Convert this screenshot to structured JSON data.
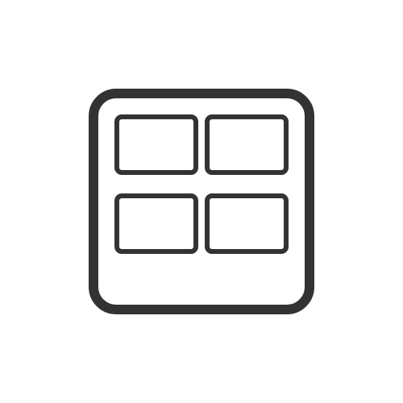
{
  "icon": {
    "name": "grid-layout-icon",
    "stroke_color": "#333333",
    "background_color": "#ffffff"
  }
}
